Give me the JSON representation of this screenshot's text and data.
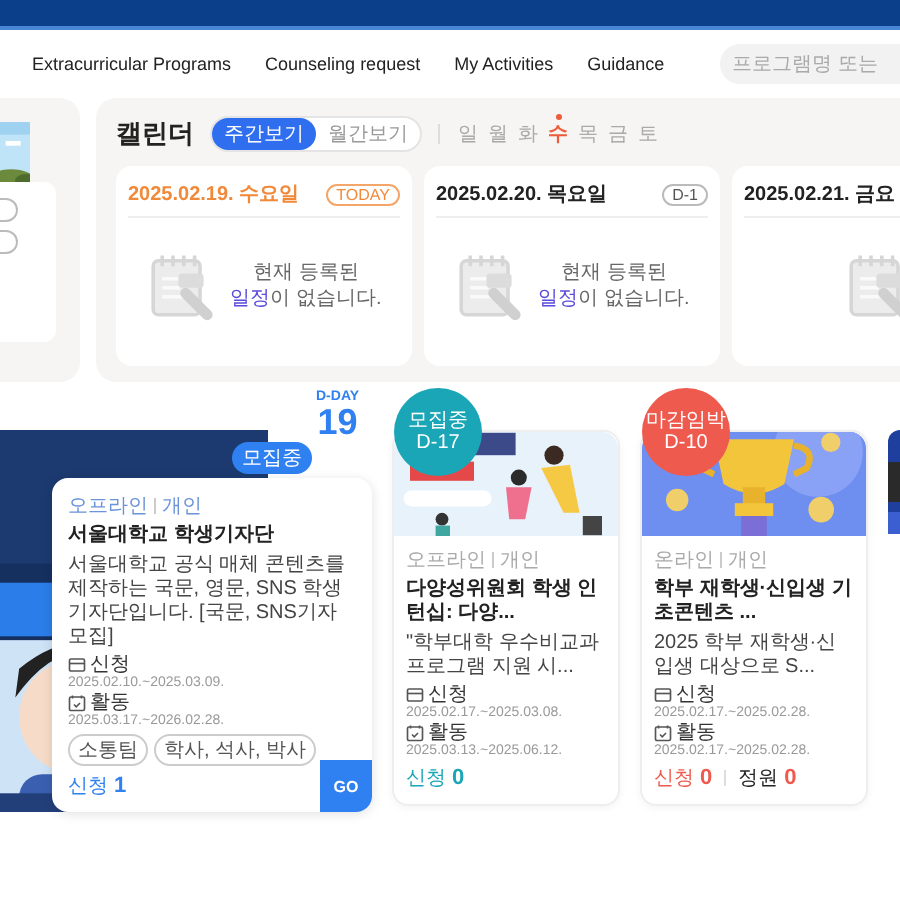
{
  "nav": {
    "items": [
      "Extracurricular Programs",
      "Counseling request",
      "My Activities",
      "Guidance"
    ],
    "search": {
      "placeholder": "프로그램명 또는"
    }
  },
  "calendar": {
    "title": "캘린더",
    "view_toggle": [
      {
        "label": "주간보기",
        "selected": true
      },
      {
        "label": "월간보기",
        "selected": false
      }
    ],
    "weekdays": [
      {
        "label": "일",
        "selected": false
      },
      {
        "label": "월",
        "selected": false
      },
      {
        "label": "화",
        "selected": false
      },
      {
        "label": "수",
        "selected": true
      },
      {
        "label": "목",
        "selected": false
      },
      {
        "label": "금",
        "selected": false
      },
      {
        "label": "토",
        "selected": false
      }
    ],
    "days": [
      {
        "date": "2025.02.19. 수요일",
        "badge": "TODAY",
        "today": true,
        "message": "현재 등록된\n**일정**이 없습니다."
      },
      {
        "date": "2025.02.20. 목요일",
        "badge": "D-1",
        "today": false,
        "message": "현재 등록된\n**일정**이 없습니다."
      },
      {
        "date": "2025.02.21. 금요",
        "today": false
      }
    ]
  },
  "programs": [
    {
      "kind": "featured",
      "status": "모집중",
      "color": "#2f80f0",
      "dday_label": "D-DAY",
      "dday": "19",
      "mode": "오프라인",
      "type": "개인",
      "title": "서울대학교 학생기자단",
      "desc": "서울대학교 공식 매체 콘텐츠를 제작하는 국문, 영문, SNS 학생기자단입니다. [국문, SNS기자 모집]",
      "apply_label": "신청",
      "apply_period": "2025.02.10.~2025.03.09.",
      "activity_label": "활동",
      "activity_period": "2025.03.17.~2026.02.28.",
      "tags": [
        "소통팀",
        "학사, 석사, 박사"
      ],
      "counts": [
        {
          "label": "신청",
          "value": "1"
        }
      ],
      "button": "GO"
    },
    {
      "kind": "card",
      "status": "모집중",
      "color": "#1aa6b7",
      "dday": "D-17",
      "mode": "오프라인",
      "type": "개인",
      "title": "다양성위원회 학생 인턴십: 다양...",
      "desc": "\"학부대학 우수비교과 프로그램 지원 시...",
      "apply_label": "신청",
      "apply_period": "2025.02.17.~2025.03.08.",
      "activity_label": "활동",
      "activity_period": "2025.03.13.~2025.06.12.",
      "counts": [
        {
          "label": "신청",
          "value": "0"
        }
      ]
    },
    {
      "kind": "card",
      "status": "마감임박",
      "color": "#ef5a4f",
      "dday": "D-10",
      "mode": "온라인",
      "type": "개인",
      "title": "학부 재학생·신입생 기초콘텐츠 ...",
      "desc": "2025 학부 재학생·신입생 대상으로 S...",
      "apply_label": "신청",
      "apply_period": "2025.02.17.~2025.02.28.",
      "activity_label": "활동",
      "activity_period": "2025.02.17.~2025.02.28.",
      "counts": [
        {
          "label": "신청",
          "value": "0"
        },
        {
          "label": "정원",
          "value": "0"
        }
      ]
    },
    {
      "kind": "picture"
    }
  ]
}
